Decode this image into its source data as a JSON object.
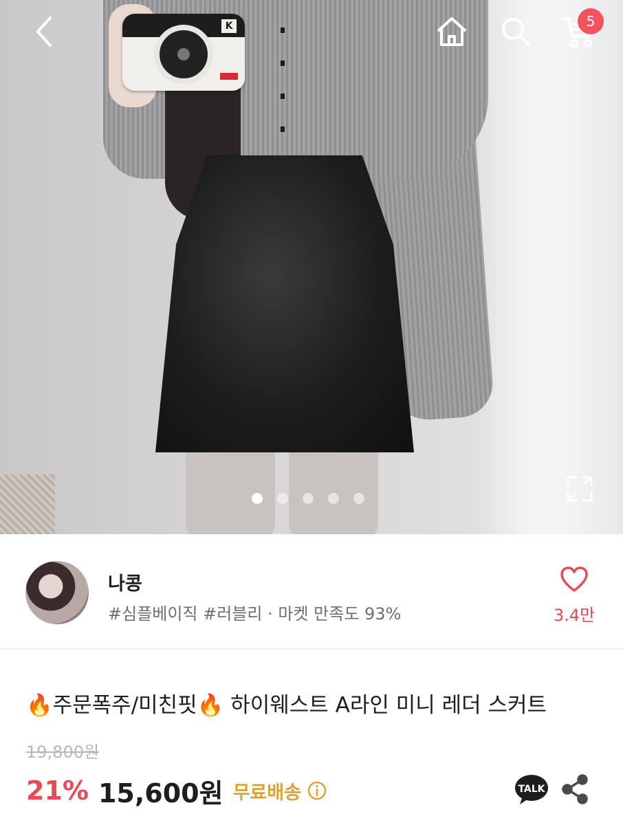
{
  "nav": {
    "back_icon": "chevron-left-icon",
    "home_icon": "home-icon",
    "search_icon": "search-icon",
    "cart_icon": "cart-icon",
    "cart_count": "5"
  },
  "gallery": {
    "image_count": 5,
    "active_index": 0,
    "expand_icon": "expand-icon",
    "camera_logo": "K"
  },
  "seller": {
    "name": "나콩",
    "tags": "#심플베이직 #러블리 · 마켓 만족도 93%",
    "likes": "3.4만",
    "heart_icon": "heart-outline-icon"
  },
  "product": {
    "title_prefix": "주문폭주/미친핏",
    "title_main": "하이웨스트 A라인 미니 레더 스커트",
    "original_price": "19,800원",
    "discount": "21%",
    "price": "15,600원",
    "shipping": "무료배송",
    "talk_label": "TALK"
  },
  "colors": {
    "accent_red": "#e64b58",
    "badge_red": "#f0545d",
    "free_shipping": "#d9a33a"
  }
}
